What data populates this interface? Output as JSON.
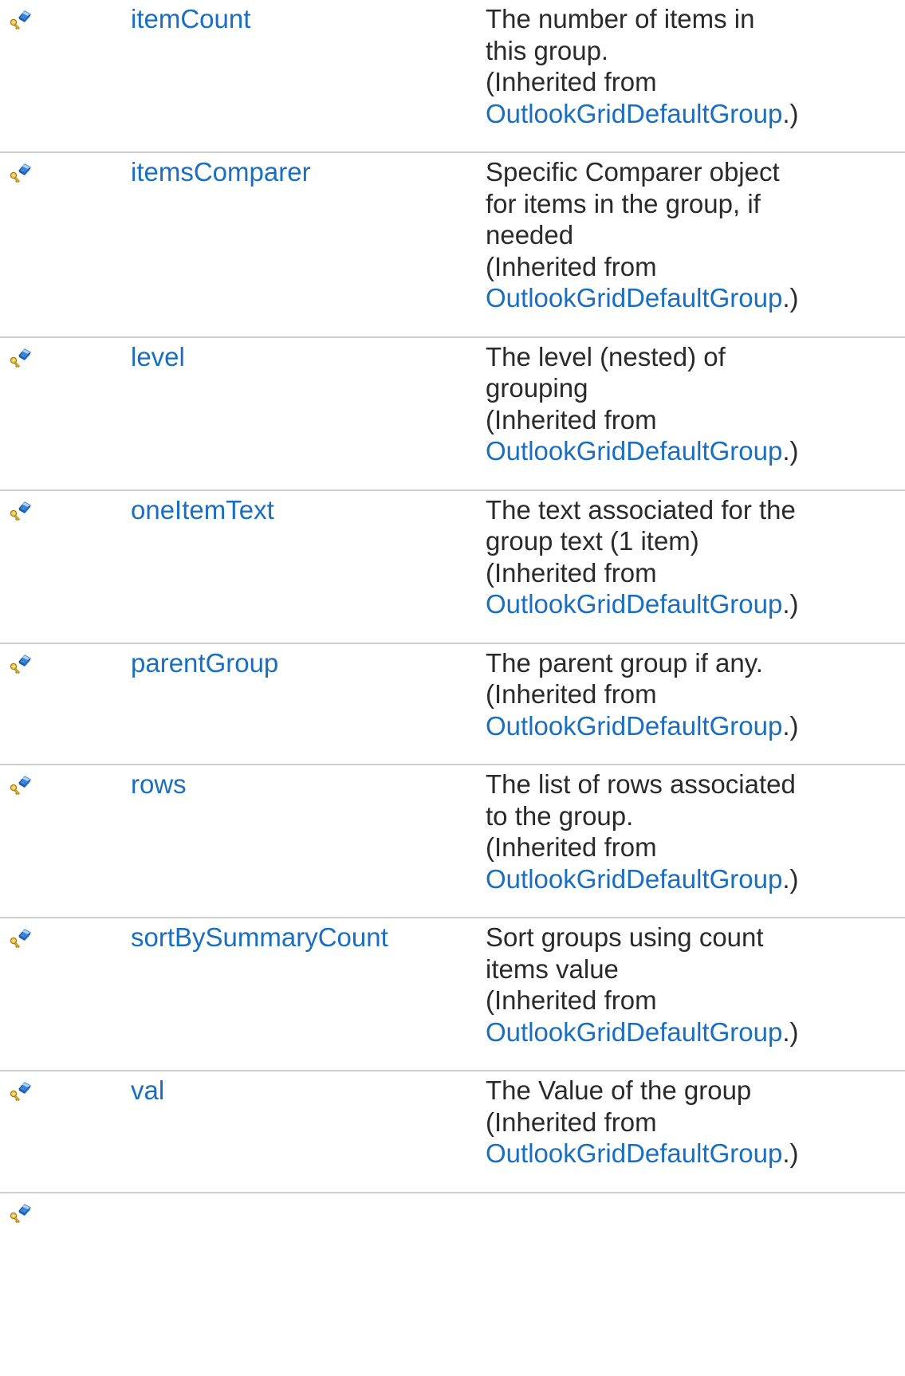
{
  "members": [
    {
      "icon": "protected-field-icon",
      "name": "itemCount",
      "description_lines": [
        "The number of items in",
        "this group."
      ],
      "inherited_prefix": "(Inherited from",
      "inherited_class": "OutlookGridDefaultGroup",
      "inherited_suffix": ".)"
    },
    {
      "icon": "protected-field-icon",
      "name": "itemsComparer",
      "description_lines": [
        "Specific Comparer object",
        "for items in the group, if",
        "needed"
      ],
      "inherited_prefix": "(Inherited from",
      "inherited_class": "OutlookGridDefaultGroup",
      "inherited_suffix": ".)"
    },
    {
      "icon": "protected-field-icon",
      "name": "level",
      "description_lines": [
        "The level (nested) of",
        "grouping"
      ],
      "inherited_prefix": "(Inherited from",
      "inherited_class": "OutlookGridDefaultGroup",
      "inherited_suffix": ".)"
    },
    {
      "icon": "protected-field-icon",
      "name": "oneItemText",
      "description_lines": [
        "The text associated for the",
        "group text (1 item)"
      ],
      "inherited_prefix": "(Inherited from",
      "inherited_class": "OutlookGridDefaultGroup",
      "inherited_suffix": ".)"
    },
    {
      "icon": "protected-field-icon",
      "name": "parentGroup",
      "description_lines": [
        "The parent group if any."
      ],
      "inherited_prefix": "(Inherited from",
      "inherited_class": "OutlookGridDefaultGroup",
      "inherited_suffix": ".)"
    },
    {
      "icon": "protected-field-icon",
      "name": "rows",
      "description_lines": [
        "The list of rows associated",
        "to the group."
      ],
      "inherited_prefix": "(Inherited from",
      "inherited_class": "OutlookGridDefaultGroup",
      "inherited_suffix": ".)"
    },
    {
      "icon": "protected-field-icon",
      "name": "sortBySummaryCount",
      "description_lines": [
        "Sort groups using count",
        "items value"
      ],
      "inherited_prefix": "(Inherited from",
      "inherited_class": "OutlookGridDefaultGroup",
      "inherited_suffix": ".)"
    },
    {
      "icon": "protected-field-icon",
      "name": "val",
      "description_lines": [
        "The Value of the group"
      ],
      "inherited_prefix": "(Inherited from",
      "inherited_class": "OutlookGridDefaultGroup",
      "inherited_suffix": ".)"
    }
  ],
  "trailing_row_icon": "protected-field-icon",
  "colors": {
    "link": "#1a6ec0",
    "text": "#2a2a2a",
    "divider": "#cfcfcf"
  }
}
